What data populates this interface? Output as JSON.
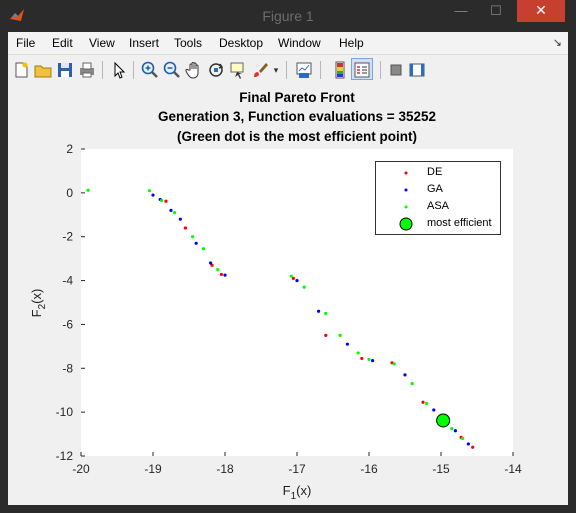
{
  "window": {
    "title": "Figure 1",
    "minimize_label": "—",
    "maximize_label": "☐",
    "close_label": "✕",
    "app_icon": "matlab-icon"
  },
  "menu": [
    "File",
    "Edit",
    "View",
    "Insert",
    "Tools",
    "Desktop",
    "Window",
    "Help"
  ],
  "toolbar": {
    "icons": [
      "new-figure-icon",
      "open-file-icon",
      "save-icon",
      "print-icon",
      "pointer-icon",
      "zoom-in-icon",
      "zoom-out-icon",
      "pan-hand-icon",
      "rotate-3d-icon",
      "data-cursor-icon",
      "brush-icon",
      "brush-dropdown-icon",
      "link-plot-icon",
      "colorbar-icon",
      "legend-icon",
      "hide-plot-tools-icon",
      "show-plot-tools-icon"
    ]
  },
  "colors": {
    "de": "#ff0000",
    "ga": "#0000ff",
    "asa": "#00ff00",
    "most_efficient": "#00ff00",
    "figure_bg": "#f0f0f0",
    "axes_bg": "#ffffff"
  },
  "chart_data": {
    "type": "scatter",
    "title": [
      "Final Pareto Front",
      "Generation 3, Function evaluations = 35252",
      "(Green dot is the most efficient point)"
    ],
    "xlabel": "F",
    "xlabel_sub": "1",
    "xlabel_suffix": "(x)",
    "ylabel": "F",
    "ylabel_sub": "2",
    "ylabel_suffix": "(x)",
    "xlim": [
      -20,
      -14
    ],
    "ylim": [
      -12,
      2
    ],
    "xticks": [
      -20,
      -19,
      -18,
      -17,
      -16,
      -15,
      -14
    ],
    "yticks": [
      2,
      0,
      -2,
      -4,
      -6,
      -8,
      -10,
      -12
    ],
    "grid": false,
    "legend_position": "top-right",
    "legend": [
      "DE",
      "GA",
      "ASA",
      "most efficient"
    ],
    "series": [
      {
        "name": "DE",
        "points": [
          [
            -18.82,
            -0.38
          ],
          [
            -18.55,
            -1.6
          ],
          [
            -18.18,
            -3.3
          ],
          [
            -18.05,
            -3.72
          ],
          [
            -16.6,
            -6.5
          ],
          [
            -16.1,
            -7.55
          ],
          [
            -15.25,
            -9.55
          ],
          [
            -14.72,
            -11.15
          ],
          [
            -14.56,
            -11.6
          ],
          [
            -15.68,
            -7.75
          ],
          [
            -17.05,
            -3.9
          ]
        ]
      },
      {
        "name": "GA",
        "points": [
          [
            -19.0,
            -0.1
          ],
          [
            -18.9,
            -0.3
          ],
          [
            -18.75,
            -0.8
          ],
          [
            -18.62,
            -1.2
          ],
          [
            -18.4,
            -2.3
          ],
          [
            -18.2,
            -3.2
          ],
          [
            -18.0,
            -3.75
          ],
          [
            -17.0,
            -4.0
          ],
          [
            -16.7,
            -5.4
          ],
          [
            -16.3,
            -6.9
          ],
          [
            -15.95,
            -7.65
          ],
          [
            -15.5,
            -8.3
          ],
          [
            -15.1,
            -9.9
          ],
          [
            -14.8,
            -10.85
          ],
          [
            -14.62,
            -11.45
          ]
        ]
      },
      {
        "name": "ASA",
        "points": [
          [
            -19.9,
            0.12
          ],
          [
            -19.05,
            0.1
          ],
          [
            -18.88,
            -0.35
          ],
          [
            -18.7,
            -0.9
          ],
          [
            -18.45,
            -2.0
          ],
          [
            -18.3,
            -2.55
          ],
          [
            -18.1,
            -3.5
          ],
          [
            -17.08,
            -3.8
          ],
          [
            -16.9,
            -4.3
          ],
          [
            -16.6,
            -5.5
          ],
          [
            -16.4,
            -6.5
          ],
          [
            -16.15,
            -7.3
          ],
          [
            -16.0,
            -7.6
          ],
          [
            -15.65,
            -7.8
          ],
          [
            -15.4,
            -8.7
          ],
          [
            -15.2,
            -9.6
          ],
          [
            -15.0,
            -10.2
          ],
          [
            -14.85,
            -10.75
          ],
          [
            -14.7,
            -11.2
          ]
        ]
      }
    ],
    "most_efficient": [
      -14.97,
      -10.38
    ]
  }
}
